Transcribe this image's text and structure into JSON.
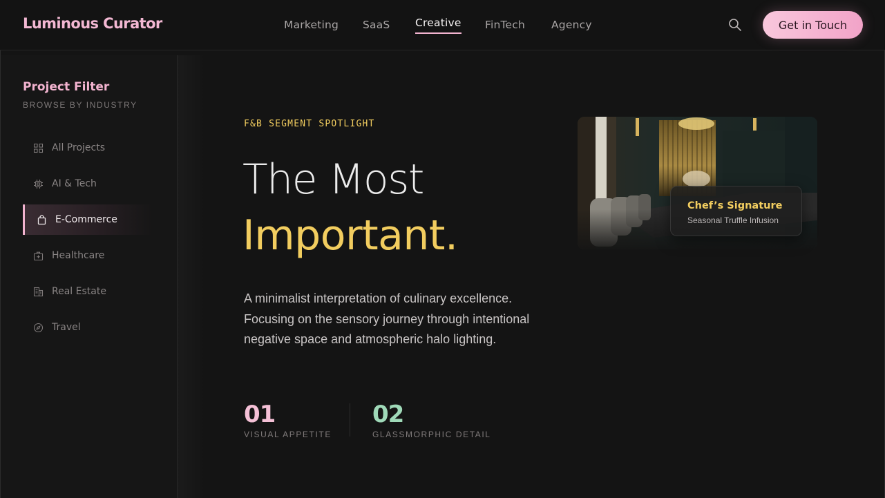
{
  "header": {
    "brand": "Luminous Curator",
    "nav": [
      {
        "label": "Marketing",
        "active": false
      },
      {
        "label": "SaaS",
        "active": false
      },
      {
        "label": "Creative",
        "active": true
      },
      {
        "label": "FinTech",
        "active": false
      },
      {
        "label": "Agency",
        "active": false
      }
    ],
    "search_icon": "search-icon",
    "cta_label": "Get in Touch"
  },
  "sidebar": {
    "title": "Project Filter",
    "subtitle": "BROWSE BY INDUSTRY",
    "items": [
      {
        "label": "All Projects",
        "icon": "grid-icon",
        "active": false
      },
      {
        "label": "AI & Tech",
        "icon": "chip-icon",
        "active": false
      },
      {
        "label": "E-Commerce",
        "icon": "shopping-bag-icon",
        "active": true
      },
      {
        "label": "Healthcare",
        "icon": "medical-kit-icon",
        "active": false
      },
      {
        "label": "Real Estate",
        "icon": "building-icon",
        "active": false
      },
      {
        "label": "Travel",
        "icon": "compass-icon",
        "active": false
      }
    ]
  },
  "main": {
    "eyebrow": "F&B SEGMENT SPOTLIGHT",
    "headline_line1": "The Most",
    "headline_line2": "Important.",
    "description": "A minimalist interpretation of culinary excellence. Focusing on the sensory journey through intentional negative space and atmospheric halo lighting.",
    "stats": [
      {
        "number": "01",
        "label": "VISUAL APPETITE",
        "color": "#f4c0d6"
      },
      {
        "number": "02",
        "label": "GLASSMORPHIC DETAIL",
        "color": "#9fd9b8"
      }
    ]
  },
  "feature_card": {
    "title": "Chef’s Signature",
    "subtitle": "Seasonal Truffle Infusion"
  },
  "colors": {
    "background": "#141414",
    "accent_pink": "#f2b3cf",
    "accent_gold": "#f2cd5f",
    "accent_mint": "#9fd9b8"
  }
}
